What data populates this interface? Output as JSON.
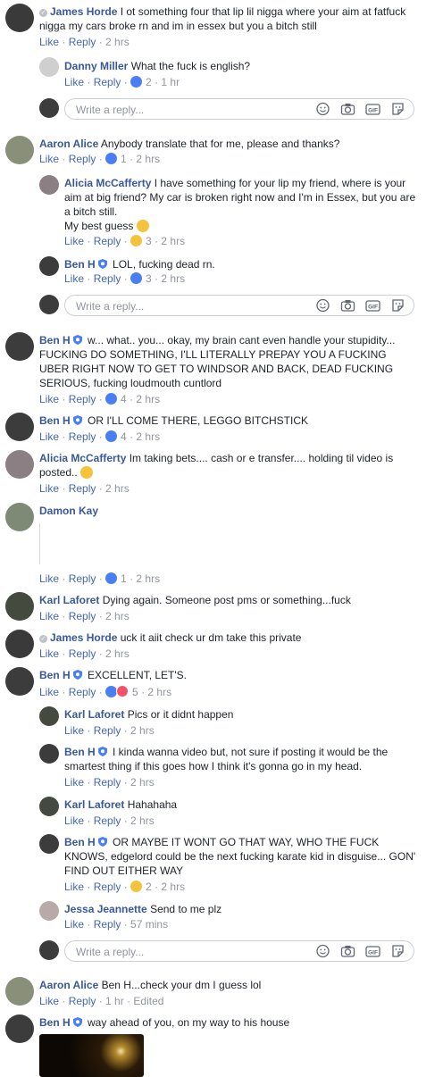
{
  "composer": {
    "placeholder": "Write a reply..."
  },
  "actions": {
    "like": "Like",
    "reply": "Reply",
    "sep": " · "
  },
  "comments": {
    "c1": {
      "author": "James Horde",
      "text": "I ot something four that lip lil nigga where your aim at fatfuck nigga my cars broke rn and im in essex but you a bitch still",
      "time": "2 hrs"
    },
    "r1": {
      "author": "Danny Miller",
      "text": "What the fuck is english?",
      "count": "2",
      "time": "1 hr"
    },
    "c2": {
      "author": "Aaron Alice",
      "text": "Anybody translate that for me, please and thanks?",
      "count": "1",
      "time": "2 hrs"
    },
    "r2": {
      "author": "Alicia McCafferty",
      "text": "I have something for your lip my friend, where is your aim at big friend? My car is broken right now and I'm in Essex, but you are a bitch still.",
      "text2": "My best guess",
      "count": "3",
      "time": "2 hrs"
    },
    "r3": {
      "author": "Ben H",
      "text": "LOL, fucking dead rn.",
      "count": "3",
      "time": "2 hrs"
    },
    "c3": {
      "author": "Ben H",
      "text": "w... what.. you... okay, my brain cant even handle your stupidity... FUCKING DO SOMETHING, I'LL LITERALLY PREPAY YOU A FUCKING UBER RIGHT NOW TO GET TO WINDSOR AND BACK, DEAD FUCKING SERIOUS, fucking loudmouth cuntlord",
      "count": "4",
      "time": "2 hrs"
    },
    "c4": {
      "author": "Ben H",
      "text": "OR I'LL COME THERE, LEGGO BITCHSTICK",
      "count": "4",
      "time": "2 hrs"
    },
    "c5": {
      "author": "Alicia McCafferty",
      "text": "Im taking bets.... cash or e transfer.... holding til video is posted..",
      "time": "2 hrs"
    },
    "c6": {
      "author": "Damon Kay",
      "count": "1",
      "time": "2 hrs"
    },
    "c7": {
      "author": "Karl Laforet",
      "text": "Dying again. Someone post pms or something...fuck",
      "time": "2 hrs"
    },
    "c8": {
      "author": "James Horde",
      "text": "uck it aiit check ur dm take this private",
      "time": "2 hrs"
    },
    "c9": {
      "author": "Ben H",
      "text": "EXCELLENT, LET'S.",
      "count": "5",
      "time": "2 hrs"
    },
    "r4": {
      "author": "Karl Laforet",
      "text": "Pics or it didnt happen",
      "time": "2 hrs"
    },
    "r5": {
      "author": "Ben H",
      "text": "I kinda wanna video but, not sure if posting it would be the smartest thing if this goes how I think it's gonna go in my head.",
      "time": "2 hrs"
    },
    "r6": {
      "author": "Karl Laforet",
      "text": "Hahahaha",
      "time": "2 hrs"
    },
    "r7": {
      "author": "Ben H",
      "text": "OR MAYBE IT WONT GO THAT WAY, WHO THE FUCK KNOWS, edgelord could be the next fucking karate kid in disguise... GON' FIND OUT EITHER WAY",
      "count": "2",
      "time": "2 hrs"
    },
    "r8": {
      "author": "Jessa Jeannette",
      "text": "Send to me plz",
      "time": "57 mins"
    },
    "c10": {
      "author": "Aaron Alice",
      "text": "Ben H...check your dm I guess lol",
      "time": "1 hr",
      "edited": "Edited"
    },
    "c11": {
      "author": "Ben H",
      "text": "way ahead of you, on my way to his house"
    }
  },
  "colors": {
    "link": "#385898",
    "meta": "#90949c",
    "like_blue": "#4a7ff3",
    "haha_yellow": "#f5c33b",
    "love_red": "#f25268"
  },
  "icons": {
    "emoji": "smiley-icon",
    "camera": "camera-icon",
    "gif": "gif-icon",
    "sticker": "sticker-icon",
    "like": "like-reaction-icon",
    "haha": "haha-reaction-icon",
    "love": "love-reaction-icon",
    "badge": "shield-badge-icon",
    "verified": "check-badge-icon"
  }
}
